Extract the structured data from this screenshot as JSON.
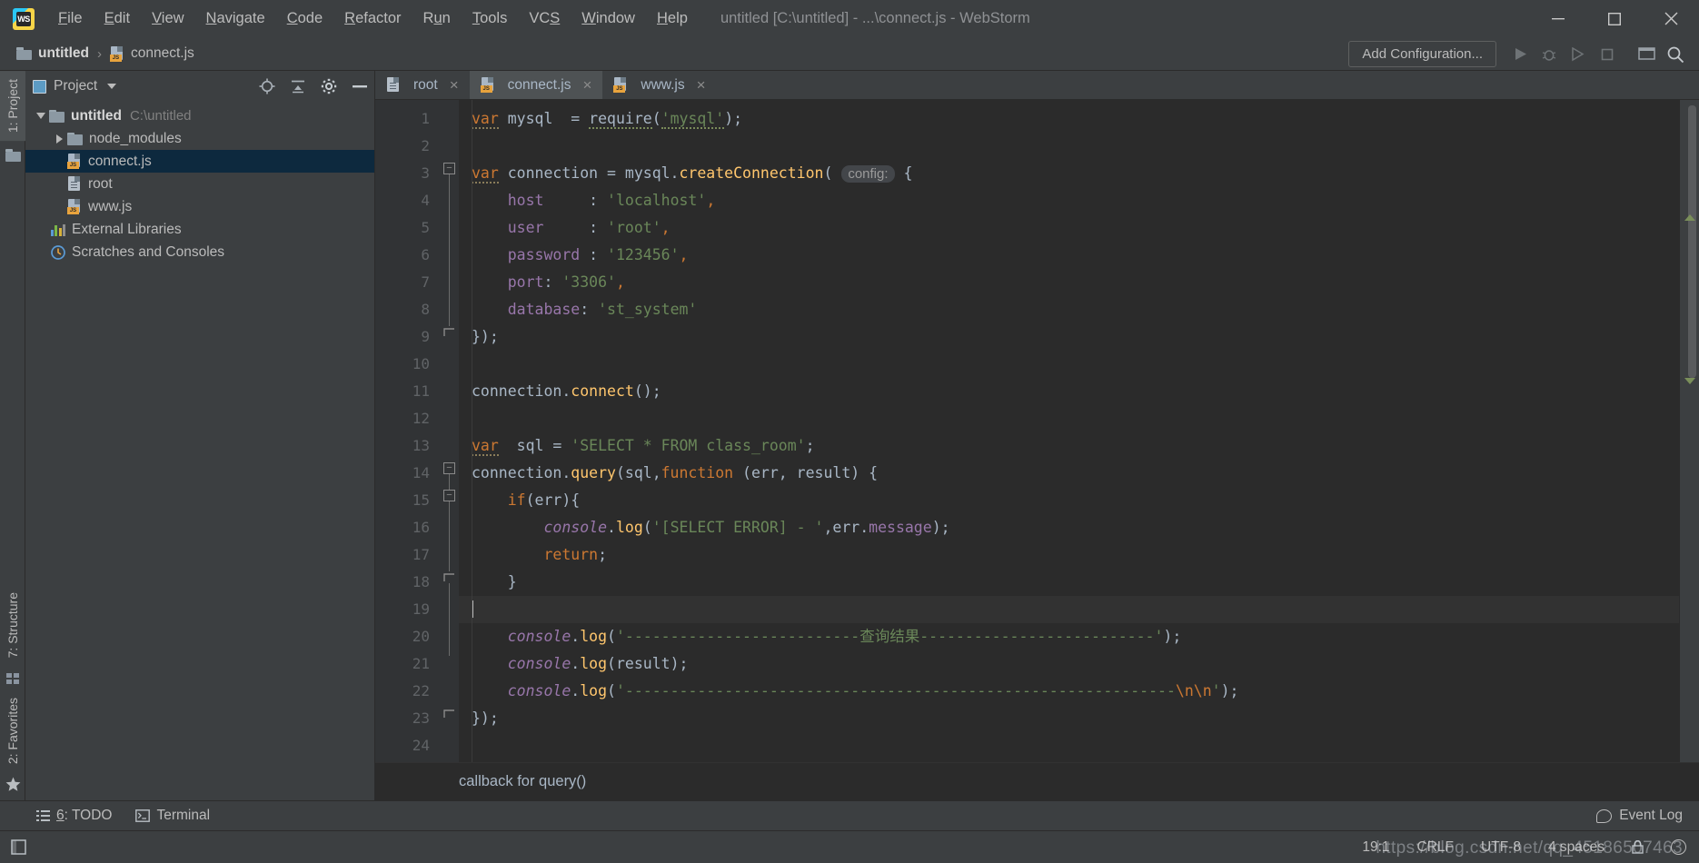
{
  "window": {
    "title": "untitled [C:\\untitled] - ...\\connect.js - WebStorm",
    "logo_text": "WS",
    "minimize": "—",
    "maximize": "☐",
    "close": "✕"
  },
  "menu": {
    "items": [
      {
        "label": "File",
        "mnemonic": "F"
      },
      {
        "label": "Edit",
        "mnemonic": "E"
      },
      {
        "label": "View",
        "mnemonic": "V"
      },
      {
        "label": "Navigate",
        "mnemonic": "N"
      },
      {
        "label": "Code",
        "mnemonic": "C"
      },
      {
        "label": "Refactor",
        "mnemonic": "R"
      },
      {
        "label": "Run",
        "mnemonic": "u"
      },
      {
        "label": "Tools",
        "mnemonic": "T"
      },
      {
        "label": "VCS",
        "mnemonic": "S"
      },
      {
        "label": "Window",
        "mnemonic": "W"
      },
      {
        "label": "Help",
        "mnemonic": "H"
      }
    ]
  },
  "navbar": {
    "crumb_project": "untitled",
    "crumb_separator": "›",
    "crumb_file": "connect.js",
    "add_configuration": "Add Configuration...",
    "icons": [
      "run-icon",
      "debug-icon",
      "run-coverage-icon",
      "stop-icon",
      "search-everywhere-icon",
      "settings-search-icon"
    ]
  },
  "left_rail": {
    "project_tab": "1: Project",
    "structure_tab": "7: Structure",
    "favorites_tab": "2: Favorites"
  },
  "project_panel": {
    "title": "Project",
    "actions": [
      "locate-icon",
      "collapse-all-icon",
      "settings-gear-icon",
      "hide-panel-icon"
    ],
    "tree": [
      {
        "label": "untitled",
        "sub": "C:\\untitled",
        "icon": "folder-icon",
        "twisty": "down",
        "indent": 0,
        "bold": true,
        "selected": false
      },
      {
        "label": "node_modules",
        "sub": "",
        "icon": "folder-icon",
        "twisty": "right",
        "indent": 1,
        "bold": false,
        "selected": false
      },
      {
        "label": "connect.js",
        "sub": "",
        "icon": "js-file-icon",
        "twisty": "none",
        "indent": 2,
        "bold": false,
        "selected": true
      },
      {
        "label": "root",
        "sub": "",
        "icon": "file-icon",
        "twisty": "none",
        "indent": 2,
        "bold": false,
        "selected": false
      },
      {
        "label": "www.js",
        "sub": "",
        "icon": "js-file-icon",
        "twisty": "none",
        "indent": 2,
        "bold": false,
        "selected": false
      },
      {
        "label": "External Libraries",
        "sub": "",
        "icon": "libraries-icon",
        "twisty": "none",
        "indent": 1,
        "bold": false,
        "selected": false
      },
      {
        "label": "Scratches and Consoles",
        "sub": "",
        "icon": "scratches-icon",
        "twisty": "none",
        "indent": 1,
        "bold": false,
        "selected": false
      }
    ]
  },
  "editor": {
    "tabs": [
      {
        "label": "root",
        "icon": "file-icon",
        "active": false
      },
      {
        "label": "connect.js",
        "icon": "js-file-icon",
        "active": true
      },
      {
        "label": "www.js",
        "icon": "js-file-icon",
        "active": false
      }
    ],
    "close_glyph": "×",
    "line_numbers": [
      1,
      2,
      3,
      4,
      5,
      6,
      7,
      8,
      9,
      10,
      11,
      12,
      13,
      14,
      15,
      16,
      17,
      18,
      19,
      20,
      21,
      22,
      23,
      24
    ],
    "current_line": 19,
    "inlay_hint_config": "config:",
    "lines": {
      "l1": "var mysql  = require('mysql');",
      "l3": "var connection = mysql.createConnection( config: {",
      "l4": "    host     : 'localhost',",
      "l5": "    user     : 'root',",
      "l6": "    password : '123456',",
      "l7": "    port: '3306',",
      "l8": "    database: 'st_system'",
      "l9": "});",
      "l11": "connection.connect();",
      "l13": "var  sql = 'SELECT * FROM class_room';",
      "l14": "connection.query(sql,function (err, result) {",
      "l15": "    if(err){",
      "l16": "        console.log('[SELECT ERROR] - ',err.message);",
      "l17": "        return;",
      "l18": "    }",
      "l20": "    console.log('--------------------------查询结果--------------------------');",
      "l21": "    console.log(result);",
      "l22": "    console.log('-------------------------------------------------------------\\n\\n');",
      "l23": "});"
    },
    "parameter_hint": "callback for query()"
  },
  "tool_windows": {
    "todo": {
      "number": "6",
      "label": ": TODO"
    },
    "terminal": "Terminal",
    "event_log": "Event Log"
  },
  "statusbar": {
    "caret_position": "19:1",
    "line_separator": "CRLF",
    "encoding": "UTF-8",
    "indent": "4 spaces",
    "lock_icon": "lock-icon",
    "face_icon": "hector-icon"
  },
  "watermark": "https://blog.csdn.net/qq_45186507463",
  "colors": {
    "background": "#3c3f41",
    "editor_background": "#2b2b2b",
    "gutter_background": "#313335",
    "selection_blue": "#0d293e",
    "keyword_orange": "#cc7832",
    "string_green": "#6a8759",
    "property_purple": "#9876aa",
    "function_yellow": "#ffc66d",
    "number_blue": "#6897bb",
    "text": "#a9b7c6"
  }
}
